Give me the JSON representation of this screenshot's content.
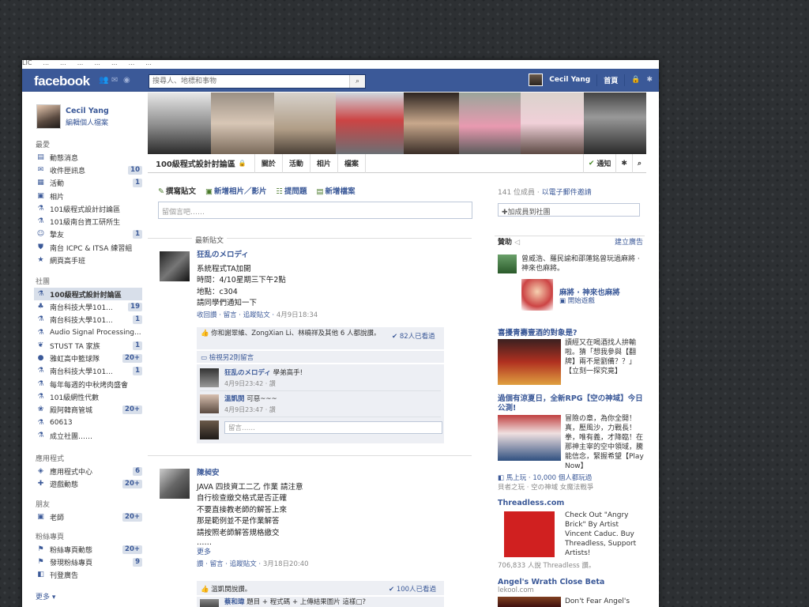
{
  "os": {
    "strip": [
      "LIC",
      "...",
      "...",
      "...",
      "...",
      "...",
      "...",
      "..."
    ]
  },
  "header": {
    "logo": "facebook",
    "search_placeholder": "搜尋人、地標和事物",
    "user": "Cecil Yang",
    "home": "首頁"
  },
  "profile": {
    "name": "Cecil Yang",
    "edit": "編輯個人檔案"
  },
  "sections": {
    "fav": "最愛",
    "groups": "社團",
    "apps": "應用程式",
    "friends": "朋友",
    "pages": "粉絲專頁",
    "more": "更多 ▾"
  },
  "favorites": [
    {
      "icon": "news-feed-icon",
      "label": "動態消息",
      "count": ""
    },
    {
      "icon": "messages-icon",
      "label": "收件匣訊息",
      "count": "10"
    },
    {
      "icon": "events-icon",
      "label": "活動",
      "count": "1"
    },
    {
      "icon": "photos-icon",
      "label": "相片",
      "count": ""
    },
    {
      "icon": "group-icon",
      "label": "101級程式設計討論區",
      "count": ""
    },
    {
      "icon": "group-icon",
      "label": "101級南台資工研所生",
      "count": ""
    },
    {
      "icon": "friends-icon",
      "label": "摯友",
      "count": "1"
    },
    {
      "icon": "badge-icon",
      "label": "南台 ICPC & ITSA 練習組",
      "count": ""
    },
    {
      "icon": "star-icon",
      "label": "網頁高手班",
      "count": ""
    }
  ],
  "groups": [
    {
      "icon": "group-icon",
      "label": "100級程式設計討論區",
      "count": "",
      "selected": true
    },
    {
      "icon": "tree-icon",
      "label": "南台科技大學101...",
      "count": "19"
    },
    {
      "icon": "group-icon",
      "label": "南台科技大學101...",
      "count": "1"
    },
    {
      "icon": "group-icon",
      "label": "Audio Signal Processing...",
      "count": ""
    },
    {
      "icon": "sprout-icon",
      "label": "STUST TA 家族",
      "count": "1"
    },
    {
      "icon": "ball-icon",
      "label": "雅虹高中籃球隊",
      "count": "20+"
    },
    {
      "icon": "group-icon",
      "label": "南台科技大學101...",
      "count": "1"
    },
    {
      "icon": "group-icon",
      "label": "每年每週的中秋烤肉盛會",
      "count": ""
    },
    {
      "icon": "group-icon",
      "label": "101級網性代數",
      "count": ""
    },
    {
      "icon": "grape-icon",
      "label": "殿阿韓商管城",
      "count": "20+"
    },
    {
      "icon": "group-icon",
      "label": "60613",
      "count": ""
    },
    {
      "icon": "flask-icon",
      "label": "成立社團……",
      "count": ""
    }
  ],
  "apps": [
    {
      "icon": "app-center-icon",
      "label": "應用程式中心",
      "count": "6"
    },
    {
      "icon": "game-icon",
      "label": "遊戲動態",
      "count": "20+"
    }
  ],
  "friends": [
    {
      "icon": "teacher-icon",
      "label": "老師",
      "count": "20+"
    }
  ],
  "pages": [
    {
      "icon": "fanpage-icon",
      "label": "粉絲專頁動態",
      "count": "20+"
    },
    {
      "icon": "fanpage-icon",
      "label": "發現粉絲專頁",
      "count": "9"
    },
    {
      "icon": "ad-icon",
      "label": "刊登廣告",
      "count": ""
    }
  ],
  "group": {
    "title": "100級程式設計討論區",
    "tabs": [
      "關於",
      "活動",
      "相片",
      "檔案"
    ],
    "notify": "通知"
  },
  "composer": {
    "tabs": [
      "撰寫貼文",
      "新增相片／影片",
      "提問題",
      "新增檔案"
    ],
    "placeholder": "留個言吧……"
  },
  "members": {
    "count": "141 位成員",
    "invite": "以電子郵件邀請",
    "add": "✚加成員到社團"
  },
  "feed": {
    "heading": "最新貼文"
  },
  "post1": {
    "author": "狂乱のメロディ",
    "lines": [
      "系統程式TA加開",
      "時間：4/10星期三下午2點",
      "地點：c304",
      "請同學們通知一下"
    ],
    "actions": "收回讚 · 留言 · 追蹤貼文 · ",
    "time": "4月9日18:34",
    "likes": "你和謝翠維、ZongXian Li、林曉祥及其他 6 人都說讚。",
    "seen": "82人已看過",
    "view_more": "檢視另2則留言",
    "comments": [
      {
        "author": "狂乱のメロディ",
        "text": "學弟高手!",
        "time": "4月9日23:42 · 讚"
      },
      {
        "author": "溫凱閔",
        "text": "可惡~~~",
        "time": "4月9日23:47 · 讚"
      }
    ],
    "comment_placeholder": "留言……"
  },
  "post2": {
    "author": "陳昶安",
    "lines": [
      "JAVA 四技資工二乙 作業 請注意",
      "自行檢查繳交格式是否正確",
      "不要直接教老師的解答上來",
      "那是範例並不是作業解答",
      "請按照老師解答規格繳交",
      "……"
    ],
    "more": "更多",
    "actions": "讚 · 留言 · 追蹤貼文 · ",
    "time": "3月18日20:40",
    "likes": "溫凱閔說讚。",
    "seen": "100人已看過",
    "c_author": "蔡和瑋",
    "c_text": "題目 + 程式碼 + 上傳結果圖片 這樣□?"
  },
  "sponsor": {
    "title": "贊助",
    "create": "建立廣告",
    "ad1": "曾威浩、羅民諭和邵蓮銘曾玩過麻將 · 神來也麻將。",
    "ad1_game": "麻將 · 神來也麻將",
    "ad1_play": "開始遊戲",
    "ad2_title": "喜擾青壽壹酒的對象是?",
    "ad2_text": "讀經又在喝酒找人拚輸啦。猜「想我參與【翻牌】兩不是劉備？？」【立刻一探究竟】",
    "ad3_title": "過個有涼夏日，全新RPG【空の神域】今日公測!",
    "ad3_text": "冒險の章，為你全開！真，壓風沙，力戰長！拳，唯有義，才降臨！在那神主宰的空中領域，騰能信念，緊握希望【Play Now】",
    "ad3_sub": "馬上玩 · 10,000 個人都玩過",
    "ad3_sub2": "貝者之玩 · 空の神域 女魔法戰爭",
    "ad4_title": "Threadless.com",
    "ad4_text": "Check Out \"Angry Brick\" By Artist Vincent Caduc. Buy Threadless, Support Artists!",
    "ad4_sub": "706,833 人說 Threadless 讚。",
    "ad5_title": "Angel's Wrath Close Beta",
    "ad5_domain": "lekool.com",
    "ad5_text": "Don't Fear Angel's Wrath! The Invasion ..."
  }
}
